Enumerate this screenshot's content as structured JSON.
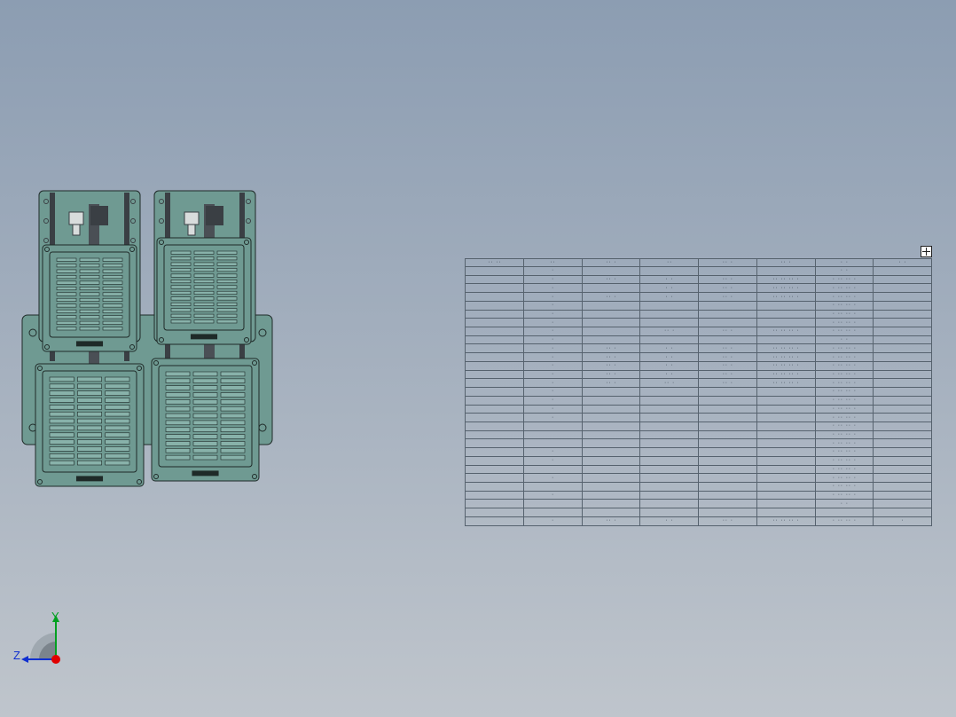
{
  "viewport": {
    "background_top": "#8c9db2",
    "background_bottom": "#bfc5cc"
  },
  "model": {
    "plate_color": "#6f9a92",
    "steel_color": "#3a3f44",
    "plate_labels": [
      "██████████",
      "██████████",
      "██████████",
      "██████████"
    ]
  },
  "bom": {
    "anchor_icon": "table-anchor-icon",
    "headers": [
      "·· ··",
      "··",
      "·· ·",
      "··",
      "·· ·",
      "·· ·",
      "· ·",
      "· ·"
    ],
    "rows": [
      [
        "",
        "·",
        "",
        "",
        "",
        "",
        "· ·",
        ""
      ],
      [
        "",
        "·",
        "·· ·",
        "· ·",
        "·· ·",
        "·· ·· ·· ·",
        "· ·· ·· ·",
        ""
      ],
      [
        "",
        "·",
        "",
        "· ·",
        "·· ·",
        "·· ·· ·· ·",
        "· ·· ·· ·",
        ""
      ],
      [
        "",
        "·",
        "·· ·",
        "· ·",
        "·· ·",
        "·· ·· ·· ·",
        "· ·· ·· ·",
        ""
      ],
      [
        "",
        "·",
        "",
        "",
        "",
        "",
        "· ·· ·· ·",
        ""
      ],
      [
        "",
        "·",
        "",
        "",
        "",
        "",
        "· ·· ·· ·",
        ""
      ],
      [
        "",
        "·",
        "",
        "",
        "",
        "",
        "· ·· ·· ·",
        ""
      ],
      [
        "",
        "·",
        "",
        "·· ·",
        "·· ·",
        "·· ·· ·· ·",
        "· ·· ·· ·",
        ""
      ],
      [
        "",
        "·",
        "",
        "",
        "",
        "",
        "· ·",
        ""
      ],
      [
        "",
        "·",
        "·· ·",
        "· ·",
        "·· ·",
        "·· ·· ·· ·",
        "· ·· ·· ·",
        ""
      ],
      [
        "",
        "·",
        "·· ·",
        "· ·",
        "·· ·",
        "·· ·· ·· ·",
        "· ·· ·· ·",
        ""
      ],
      [
        "",
        "·",
        "·· ·",
        "· ·",
        "·· ·",
        "·· ·· ·· ·",
        "· ·· ·· ·",
        ""
      ],
      [
        "",
        "·",
        "·· ·",
        "· ·",
        "·· ·",
        "·· ·· ·· ·",
        "· ·· ·· ·",
        ""
      ],
      [
        "",
        "·",
        "·· ·",
        "·· ·",
        "·· ·",
        "·· ·· ·· ·",
        "· ·· ·· ·",
        ""
      ],
      [
        "",
        "·",
        "",
        "",
        "",
        "",
        "· ·· ·· ·",
        ""
      ],
      [
        "",
        "·",
        "",
        "",
        "",
        "",
        "· ·· ·· ·",
        ""
      ],
      [
        "",
        "·",
        "",
        "",
        "",
        "",
        "· ·· ·· ·",
        ""
      ],
      [
        "",
        "·",
        "",
        "",
        "",
        "",
        "· ·· ·· ·",
        ""
      ],
      [
        "",
        "",
        "",
        "",
        "",
        "",
        "· ·· ·· ·",
        ""
      ],
      [
        "",
        "",
        "",
        "",
        "",
        "",
        "· ·· ·· ·",
        ""
      ],
      [
        "",
        "",
        "",
        "",
        "",
        "",
        "· ·· ·· ·",
        ""
      ],
      [
        "",
        "·",
        "",
        "",
        "",
        "",
        "· ·· ·· ·",
        ""
      ],
      [
        "",
        "·",
        "",
        "",
        "",
        "",
        "· ·· ·· ·",
        ""
      ],
      [
        "",
        "",
        "",
        "",
        "",
        "",
        "· ·· ·· ·",
        ""
      ],
      [
        "",
        "·",
        "",
        "",
        "",
        "",
        "· ·· ·· ·",
        ""
      ],
      [
        "",
        "",
        "",
        "",
        "",
        "",
        "· ·· ·· ·",
        ""
      ],
      [
        "",
        "·",
        "",
        "",
        "",
        "",
        "· ·· ·· ·",
        ""
      ],
      [
        "",
        "",
        "",
        "",
        "",
        "",
        "· ·",
        ""
      ],
      [
        "",
        "",
        "",
        "",
        "",
        "",
        "",
        ""
      ],
      [
        "",
        "·",
        "·· ·",
        "· ·",
        "·· ·",
        "·· ·· ·· ·",
        "· ·· ·· ·",
        "·"
      ]
    ]
  },
  "triad": {
    "y_label": "Y",
    "z_label": "Z",
    "y_color": "#00a020",
    "z_color": "#1030d0",
    "x_color": "#e00000"
  }
}
